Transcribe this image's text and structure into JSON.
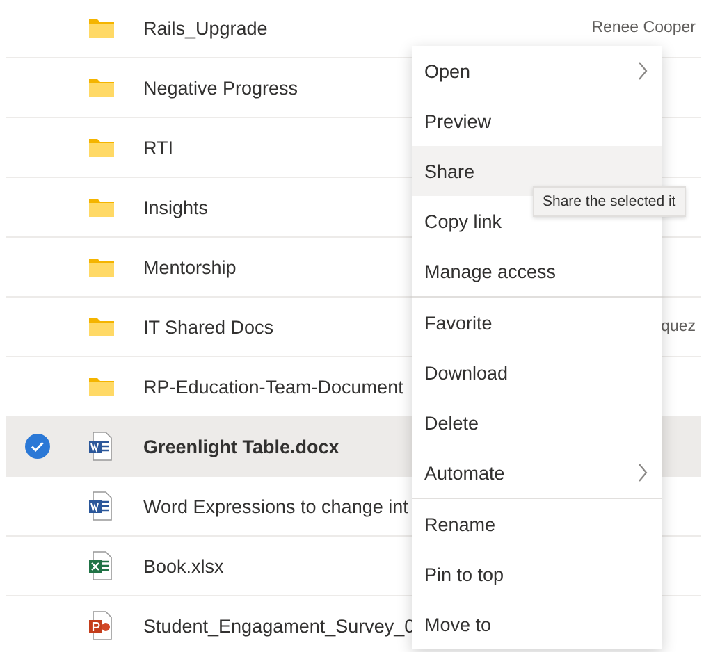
{
  "files": [
    {
      "name": "Rails_Upgrade",
      "kind": "folder",
      "selected": false,
      "column_2": "Renee Cooper"
    },
    {
      "name": "Negative Progress",
      "kind": "folder",
      "selected": false
    },
    {
      "name": "RTI",
      "kind": "folder",
      "selected": false
    },
    {
      "name": "Insights",
      "kind": "folder",
      "selected": false
    },
    {
      "name": "Mentorship",
      "kind": "folder",
      "selected": false
    },
    {
      "name": "IT Shared Docs",
      "kind": "folder",
      "selected": false,
      "column_2": "quez"
    },
    {
      "name": "RP-Education-Team-Document",
      "kind": "folder",
      "selected": false
    },
    {
      "name": "Greenlight Table.docx",
      "kind": "word",
      "selected": true
    },
    {
      "name": "Word Expressions to change int",
      "kind": "word",
      "selected": false
    },
    {
      "name": "Book.xlsx",
      "kind": "excel",
      "selected": false
    },
    {
      "name": "Student_Engagament_Survey_0",
      "kind": "powerpoint",
      "selected": false
    }
  ],
  "context_menu": {
    "groups": [
      [
        {
          "label": "Open",
          "submenu": true,
          "selected": false
        },
        {
          "label": "Preview",
          "submenu": false,
          "selected": false
        },
        {
          "label": "Share",
          "submenu": false,
          "selected": true
        },
        {
          "label": "Copy link",
          "submenu": false,
          "selected": false
        },
        {
          "label": "Manage access",
          "submenu": false,
          "selected": false
        }
      ],
      [
        {
          "label": "Favorite",
          "submenu": false,
          "selected": false
        },
        {
          "label": "Download",
          "submenu": false,
          "selected": false
        },
        {
          "label": "Delete",
          "submenu": false,
          "selected": false
        },
        {
          "label": "Automate",
          "submenu": true,
          "selected": false
        }
      ],
      [
        {
          "label": "Rename",
          "submenu": false,
          "selected": false
        },
        {
          "label": "Pin to top",
          "submenu": false,
          "selected": false
        },
        {
          "label": "Move to",
          "submenu": false,
          "selected": false
        }
      ]
    ]
  },
  "tooltip": {
    "text": "Share the selected it"
  }
}
